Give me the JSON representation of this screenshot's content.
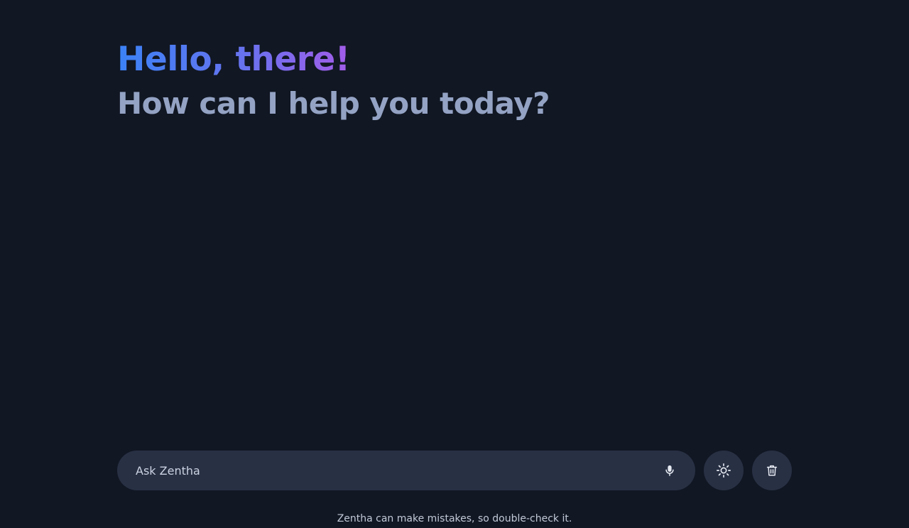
{
  "header": {
    "greeting": "Hello, there!",
    "subtitle": "How can I help you today?"
  },
  "prompt": {
    "placeholder": "Ask Zentha",
    "value": ""
  },
  "buttons": {
    "mic_icon": "microphone-icon",
    "theme_icon": "sun-icon",
    "delete_icon": "trash-icon"
  },
  "footer": {
    "disclaimer": "Zentha can make mistakes, so double-check it."
  },
  "colors": {
    "background": "#111723",
    "surface": "#283044",
    "greeting_gradient_start": "#3b82f6",
    "greeting_gradient_end": "#a35ce9",
    "subtitle": "#94a3c4"
  }
}
